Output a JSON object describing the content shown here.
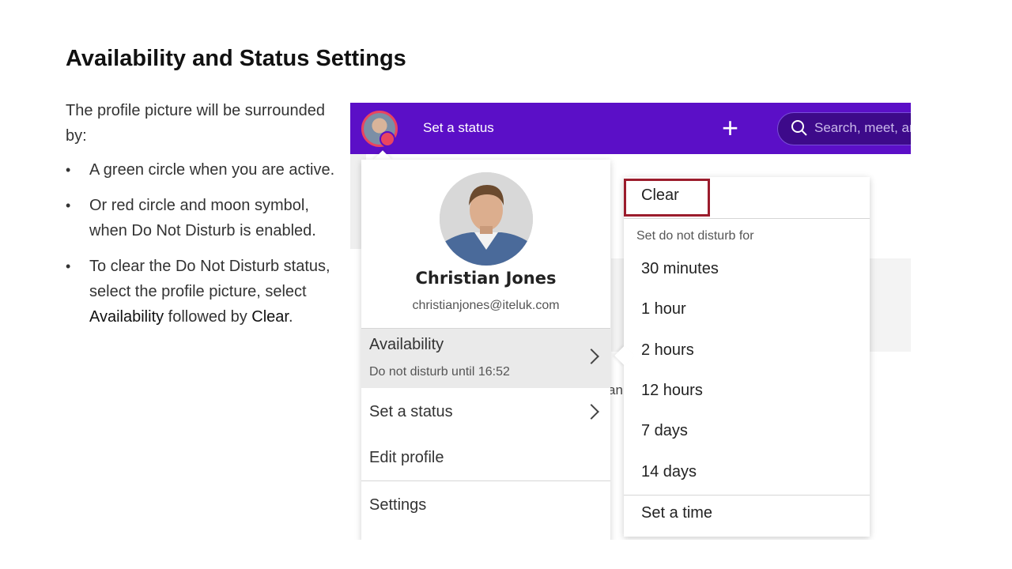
{
  "slide": {
    "title": "Availability and Status Settings",
    "intro": "The profile picture will be surrounded by:",
    "bullets": [
      {
        "text": "A green circle when you are active."
      },
      {
        "text": "Or red circle and moon symbol, when Do Not Disturb is enabled."
      },
      {
        "pre": "To clear the Do Not Disturb status, select the profile picture, select ",
        "b1": "Availability",
        "mid": " followed by ",
        "b2": "Clear",
        "post": "."
      }
    ]
  },
  "topbar": {
    "status_label": "Set a status",
    "search_placeholder": "Search, meet, an",
    "brand_color": "#5b0fc7"
  },
  "profile_menu": {
    "name": "Christian Jones",
    "email": "christianjones@iteluk.com",
    "availability_label": "Availability",
    "availability_sub": "Do not disturb until 16:52",
    "set_status_label": "Set a status",
    "edit_profile_label": "Edit profile",
    "settings_label": "Settings"
  },
  "dnd_menu": {
    "clear_label": "Clear",
    "heading": "Set do not disturb for",
    "options": [
      "30 minutes",
      "1 hour",
      "2 hours",
      "12 hours",
      "7 days",
      "14 days"
    ],
    "set_time_label": "Set a time",
    "highlight_color": "#9b1c2c"
  },
  "background": {
    "partial_text": "an"
  }
}
